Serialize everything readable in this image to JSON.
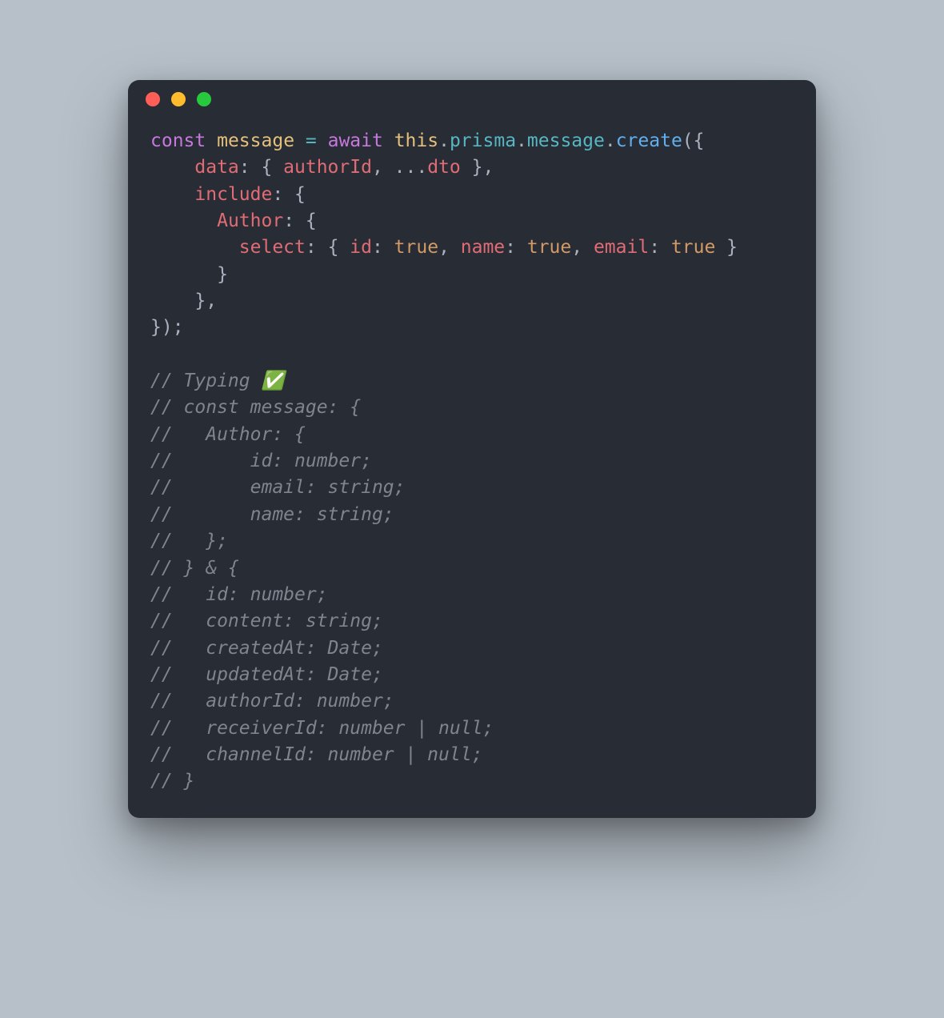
{
  "colors": {
    "background": "#b7c0c9",
    "editor_bg": "#282c34",
    "fg": "#abb2bf",
    "red_dot": "#ff5f56",
    "yellow_dot": "#ffbd2e",
    "green_dot": "#27c93f",
    "keyword": "#c678dd",
    "variable": "#e5c07b",
    "operator": "#56b6c2",
    "property": "#e06c75",
    "object": "#56b6c2",
    "function": "#61afef",
    "boolean": "#d19a66",
    "comment": "#7f848e"
  },
  "tokens": {
    "kw_const": "const",
    "sp": " ",
    "var_message": "message",
    "op_eq": " = ",
    "kw_await": "await",
    "this": "this",
    "dot": ".",
    "obj_prisma": "prisma",
    "obj_message": "message",
    "fn_create": "create",
    "open_call": "({",
    "nl": "\n",
    "indent2": "    ",
    "indent3": "      ",
    "indent4": "        ",
    "prop_data": "data",
    "colon_brace": ": { ",
    "prop_authorId": "authorId",
    "comma_sp": ", ",
    "spread": "...",
    "prop_dto": "dto",
    "close_brace_comma": " },",
    "prop_include": "include",
    "colon_brace2": ": {",
    "prop_Author": "Author",
    "prop_select": "select",
    "prop_id": "id",
    "colon_sp": ": ",
    "bool_true": "true",
    "prop_name": "name",
    "prop_email": "email",
    "close_brace_sp": " }",
    "close_brace": "}",
    "close_brace_comma2": "},",
    "close_call": "});"
  },
  "comments": {
    "c01": "// Typing ✅",
    "c02": "// const message: {",
    "c03": "//   Author: {",
    "c04": "//       id: number;",
    "c05": "//       email: string;",
    "c06": "//       name: string;",
    "c07": "//   };",
    "c08": "// } & {",
    "c09": "//   id: number;",
    "c10": "//   content: string;",
    "c11": "//   createdAt: Date;",
    "c12": "//   updatedAt: Date;",
    "c13": "//   authorId: number;",
    "c14": "//   receiverId: number | null;",
    "c15": "//   channelId: number | null;",
    "c16": "// }"
  }
}
